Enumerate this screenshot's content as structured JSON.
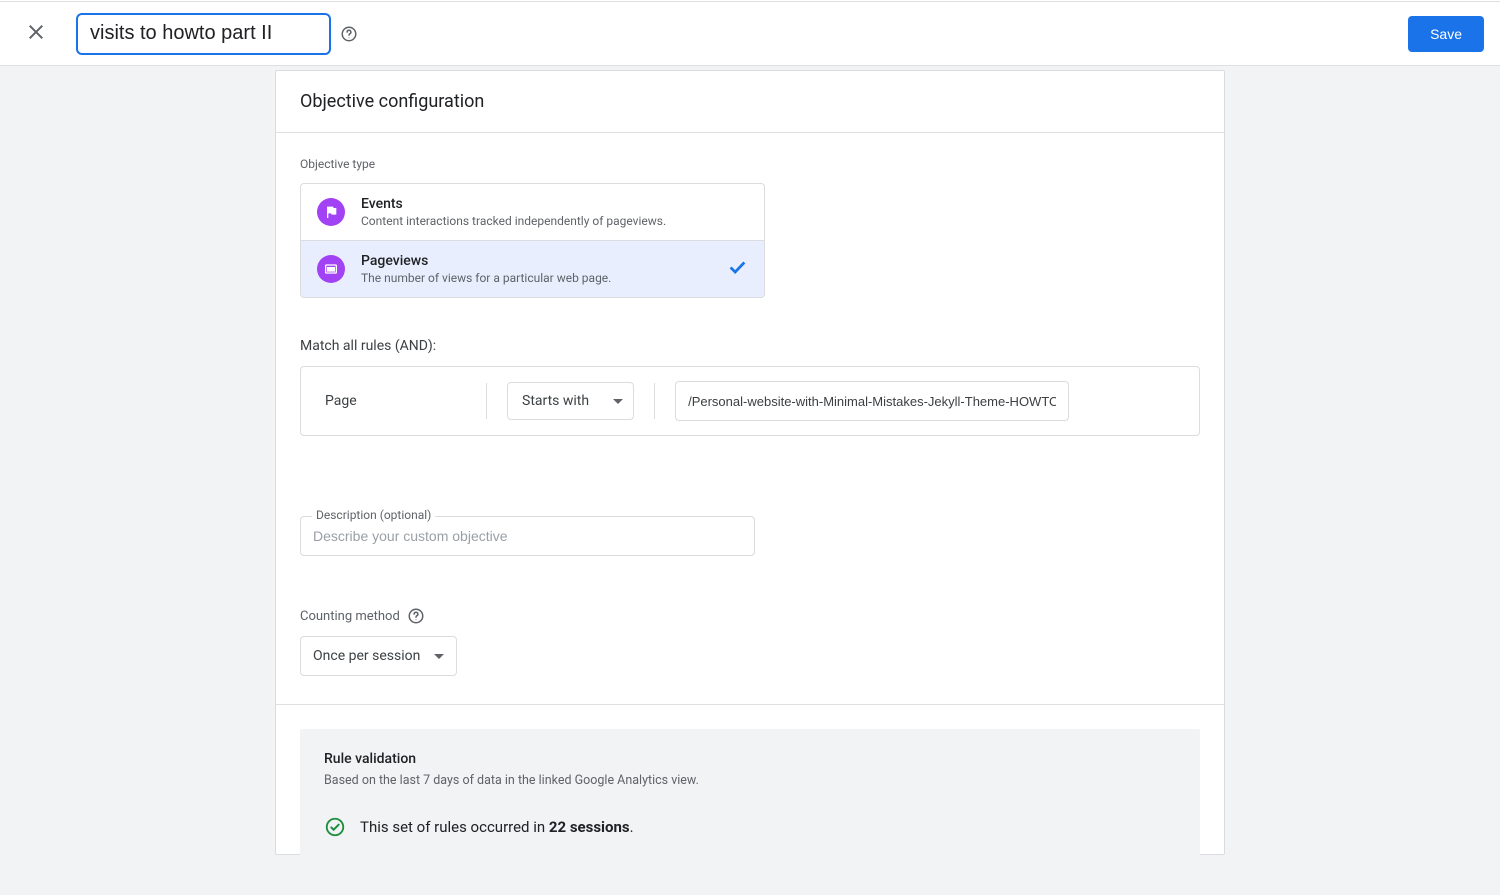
{
  "header": {
    "title_value": "visits to howto part II",
    "save_label": "Save"
  },
  "card": {
    "title": "Objective configuration"
  },
  "objective_type": {
    "label": "Objective type",
    "options": [
      {
        "title": "Events",
        "subtitle": "Content interactions tracked independently of pageviews.",
        "selected": false,
        "icon": "flag"
      },
      {
        "title": "Pageviews",
        "subtitle": "The number of views for a particular web page.",
        "selected": true,
        "icon": "page"
      }
    ]
  },
  "rules": {
    "label": "Match all rules (AND):",
    "dimension": "Page",
    "operator": "Starts with",
    "value": "/Personal-website-with-Minimal-Mistakes-Jekyll-Theme-HOWTO-I"
  },
  "description": {
    "label": "Description (optional)",
    "placeholder": "Describe your custom objective",
    "value": ""
  },
  "counting": {
    "label": "Counting method",
    "value": "Once per session"
  },
  "validation": {
    "title": "Rule validation",
    "subtitle": "Based on the last 7 days of data in the linked Google Analytics view.",
    "result_prefix": "This set of rules occurred in ",
    "result_count": "22 sessions",
    "result_suffix": "."
  }
}
